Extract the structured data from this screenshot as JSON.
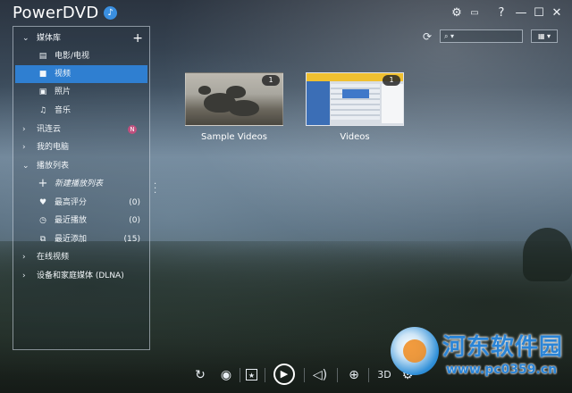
{
  "app": {
    "title": "PowerDVD"
  },
  "titlebar": {
    "settings": "⚙",
    "tv_mode": "📺",
    "help": "?",
    "minimize": "—",
    "maximize": "☐",
    "close": "✕"
  },
  "sidebar": {
    "media_library": "媒体库",
    "movies_tv": "电影/电视",
    "videos": "视频",
    "photos": "照片",
    "music": "音乐",
    "cloud": "讯连云",
    "cloud_badge": "N",
    "my_computer": "我的电脑",
    "playlists": "播放列表",
    "new_playlist": "新建播放列表",
    "top_rated": "最高评分",
    "top_rated_count": "(0)",
    "recently_played": "最近播放",
    "recently_played_count": "(0)",
    "recently_added": "最近添加",
    "recently_added_count": "(15)",
    "online_videos": "在线视频",
    "dlna": "设备和家庭媒体 (DLNA)"
  },
  "tiles": [
    {
      "label": "Sample Videos",
      "count": "1"
    },
    {
      "label": "Videos",
      "count": "1"
    }
  ],
  "bottombar": {
    "threed": "3D"
  },
  "watermark": {
    "name": "河东软件园",
    "url": "www.pc0359.cn"
  },
  "colors": {
    "accent": "#2f7fd1",
    "badge": "#c0507e"
  },
  "icons": [
    "bell-icon",
    "settings-icon",
    "tv-icon",
    "help-icon",
    "minimize-icon",
    "maximize-icon",
    "close-icon",
    "refresh-icon",
    "search-icon",
    "grid-view-icon",
    "film-icon",
    "video-icon",
    "photo-icon",
    "music-icon",
    "heart-icon",
    "clock-icon",
    "recent-add-icon",
    "repeat-icon",
    "eye-icon",
    "star-icon",
    "play-icon",
    "volume-icon",
    "zoom-icon",
    "gear-icon"
  ]
}
